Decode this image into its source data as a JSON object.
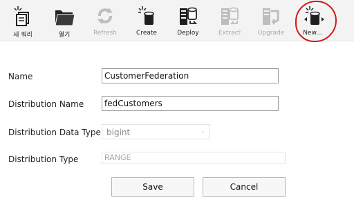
{
  "toolbar": {
    "buttons": [
      {
        "label": "새 쿼리",
        "icon": "new-query-icon",
        "enabled": true
      },
      {
        "label": "열기",
        "icon": "folder-open-icon",
        "enabled": true
      },
      {
        "label": "Refresh",
        "icon": "refresh-icon",
        "enabled": false
      },
      {
        "label": "Create",
        "icon": "create-database-icon",
        "enabled": true
      },
      {
        "label": "Deploy",
        "icon": "deploy-icon",
        "enabled": true
      },
      {
        "label": "Extract",
        "icon": "extract-icon",
        "enabled": false
      },
      {
        "label": "Upgrade",
        "icon": "upgrade-icon",
        "enabled": false
      },
      {
        "label": "New...",
        "icon": "new-federation-icon",
        "enabled": true
      }
    ]
  },
  "form": {
    "name_label": "Name",
    "name_value": "CustomerFederation",
    "dist_name_label": "Distribution Name",
    "dist_name_value": "fedCustomers",
    "dist_type_label": "Distribution Data Type",
    "dist_type_value": "bigint",
    "type_label": "Distribution Type",
    "type_value": "RANGE"
  },
  "buttons": {
    "save": "Save",
    "cancel": "Cancel"
  },
  "colors": {
    "annotation": "#d11a1a",
    "toolbar_bg": "#f3f3f3",
    "disabled": "#a8a8a8"
  }
}
